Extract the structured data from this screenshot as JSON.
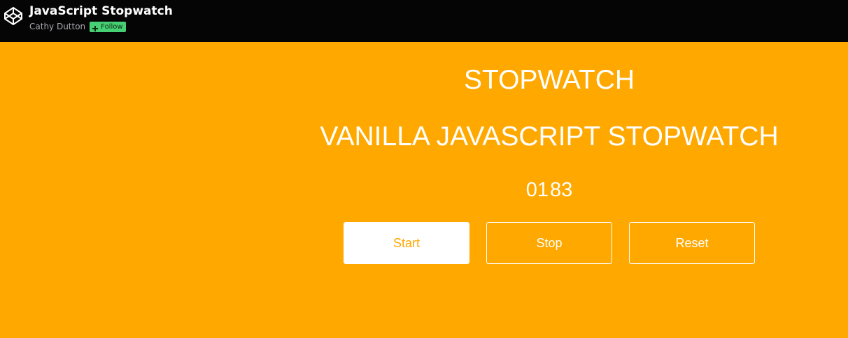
{
  "header": {
    "pen_title": "JavaScript Stopwatch",
    "author": "Cathy Dutton",
    "follow_label": "Follow",
    "logo_icon": "codepen-logo-icon",
    "follow_icon": "plus-icon"
  },
  "stopwatch": {
    "title": "STOPWATCH",
    "subtitle": "VANILLA JAVASCRIPT STOPWATCH",
    "seconds": "01",
    "tens": "83",
    "buttons": {
      "start": "Start",
      "stop": "Stop",
      "reset": "Reset"
    }
  },
  "colors": {
    "background": "#ffa800",
    "header_bg": "#050505",
    "text": "#ffffff",
    "follow_button": "#47cf73",
    "start_button_bg": "#ffffff",
    "start_button_text": "#ffa800"
  }
}
